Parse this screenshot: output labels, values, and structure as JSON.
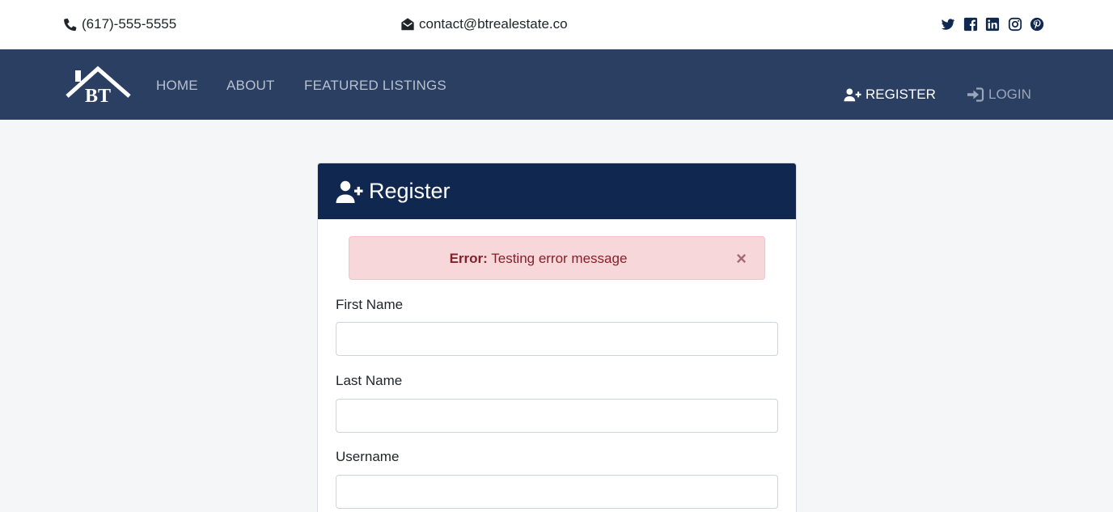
{
  "topbar": {
    "phone": "(617)-555-5555",
    "email": "contact@btrealestate.co",
    "social_icons": [
      "twitter-icon",
      "facebook-icon",
      "linkedin-icon",
      "instagram-icon",
      "pinterest-icon"
    ]
  },
  "nav": {
    "logo_text": "BT",
    "links": [
      "HOME",
      "ABOUT",
      "FEATURED LISTINGS"
    ],
    "register": "REGISTER",
    "login": "LOGIN"
  },
  "form": {
    "title": "Register",
    "alert_label": "Error:",
    "alert_message": "Testing error message",
    "alert_close": "×",
    "fields": [
      {
        "label": "First Name",
        "value": ""
      },
      {
        "label": "Last Name",
        "value": ""
      },
      {
        "label": "Username",
        "value": ""
      }
    ]
  },
  "colors": {
    "navbar": "#2b3f63",
    "card_header": "#10284f",
    "alert_bg": "#f8d7da",
    "alert_text": "#842029"
  }
}
